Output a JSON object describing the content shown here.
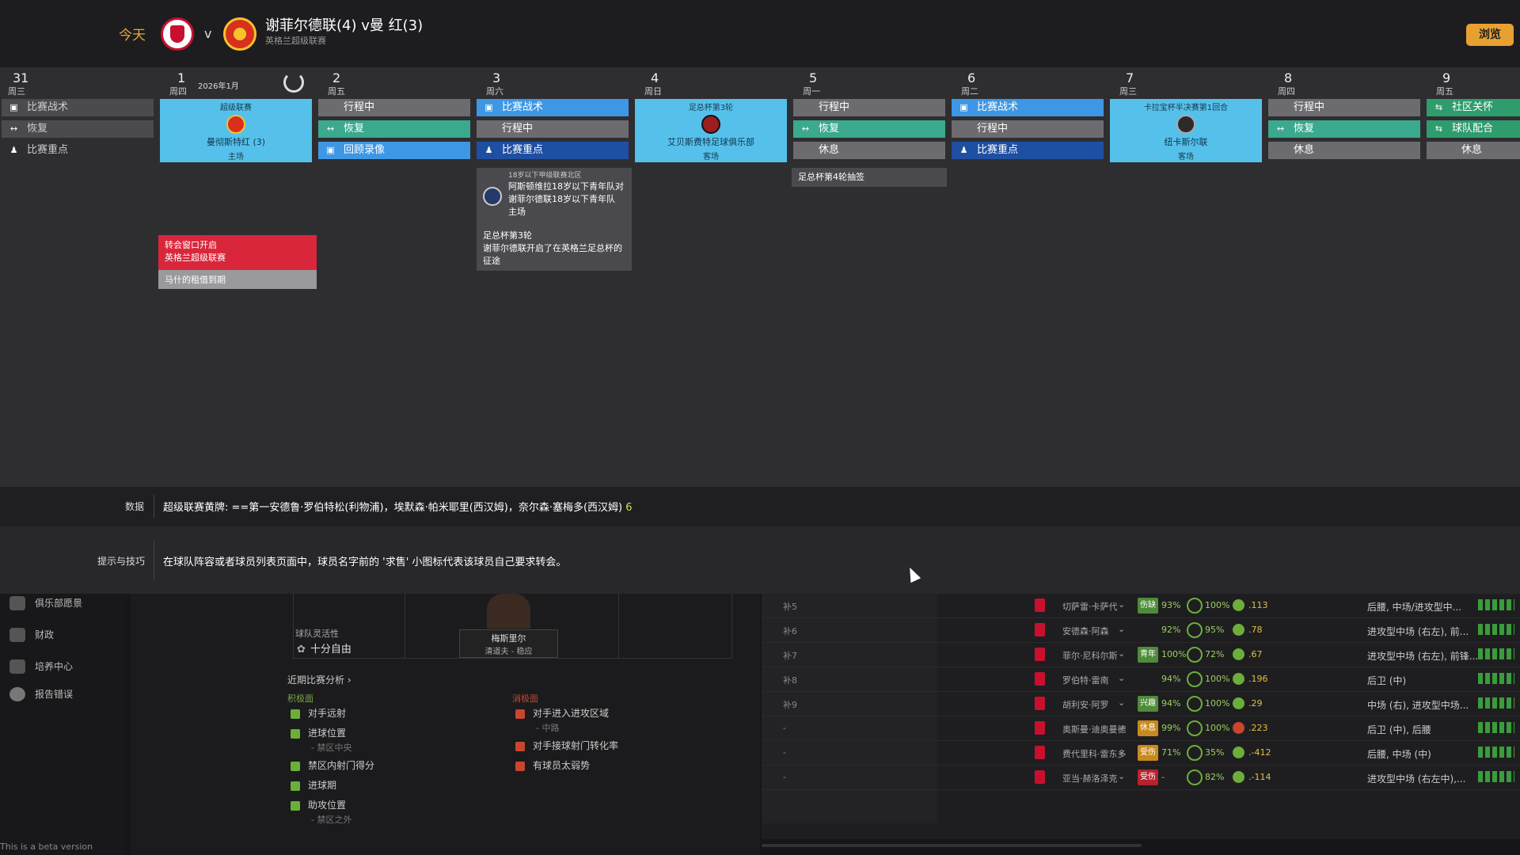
{
  "header": {
    "today_label": "今天",
    "vs": "v",
    "match_title": "谢菲尔德联(4) v曼 红(3)",
    "competition": "英格兰超级联赛",
    "browse_button": "浏览"
  },
  "calendar": {
    "month_label": "2026年1月",
    "days": [
      {
        "num": "31",
        "weekday": "周三"
      },
      {
        "num": "1",
        "weekday": "周四"
      },
      {
        "num": "2",
        "weekday": "周五"
      },
      {
        "num": "3",
        "weekday": "周六"
      },
      {
        "num": "4",
        "weekday": "周日"
      },
      {
        "num": "5",
        "weekday": "周一"
      },
      {
        "num": "6",
        "weekday": "周二"
      },
      {
        "num": "7",
        "weekday": "周三"
      },
      {
        "num": "8",
        "weekday": "周四"
      },
      {
        "num": "9",
        "weekday": "周五"
      }
    ],
    "labels": {
      "tactics": "比赛战术",
      "recovery": "恢复",
      "focus": "比赛重点",
      "travel": "行程中",
      "review": "回顾录像",
      "rest": "休息",
      "community": "社区关怀",
      "teamwork": "球队配合"
    },
    "match1": {
      "comp": "超级联赛",
      "opp": "曼彻斯特红 (3)",
      "venue": "主场"
    },
    "match4": {
      "comp": "足总杯第3轮",
      "opp": "艾贝斯费特足球俱乐部",
      "venue": "客场"
    },
    "match7": {
      "comp": "卡拉宝杯半决赛第1回合",
      "opp": "纽卡斯尔联",
      "venue": "客场"
    },
    "events": {
      "transfer_line1": "转会窗口开启",
      "transfer_line2": "英格兰超级联赛",
      "loan_end": "马什的租借到期",
      "u18_comp": "18岁以下甲级联赛北区",
      "u18_text": "阿斯顿维拉18岁以下青年队对谢菲尔德联18岁以下青年队",
      "u18_venue": "主场",
      "facup_title": "足总杯第3轮",
      "facup_text": "谢菲尔德联开启了在英格兰足总杯的征途",
      "facup_draw": "足总杯第4轮抽签"
    }
  },
  "infobar": {
    "label": "数据",
    "text": "超级联赛黄牌: ==第一安德鲁·罗伯特松(利物浦)，埃默森·帕米耶里(西汉姆)，奈尔森·塞梅多(西汉姆)",
    "number": "6"
  },
  "tipbar": {
    "label": "提示与技巧",
    "text": "在球队阵容或者球员列表页面中，球员名字前的 '求售' 小图标代表该球员自己要求转会。"
  },
  "sidenav": {
    "items": [
      "俱乐部愿景",
      "财政",
      "培养中心",
      "报告错误"
    ]
  },
  "tactics": {
    "flex_label": "球队灵活性",
    "flex_value": "十分自由",
    "player_name": "梅斯里尔",
    "player_role": "清道夫 - 稳应",
    "analysis_link": "近期比赛分析 ›",
    "positive_header": "积极面",
    "negative_header": "消极面",
    "positives": [
      "对手远射",
      "进球位置",
      "禁区内射门得分",
      "进球期",
      "助攻位置"
    ],
    "positive_subs": [
      "- 禁区中央",
      "- 禁区之外"
    ],
    "negatives": [
      "对手进入进攻区域",
      "对手接球射门转化率",
      "有球员太弱势"
    ],
    "negative_sub": "- 中路"
  },
  "squad": {
    "rows": [
      {
        "label": "补5",
        "name": "切萨雷·卡萨代",
        "tag": "伤缺",
        "cond": "93%",
        "sharp": "100%",
        "rating": ".113",
        "pos": "后腰, 中场/进攻型中...",
        "tag_color": "#4e8c3a",
        "status": "ok"
      },
      {
        "label": "补6",
        "name": "安德森·阿森",
        "tag": "",
        "cond": "92%",
        "sharp": "95%",
        "rating": ".78",
        "pos": "进攻型中场 (右左), 前...",
        "tag_color": "",
        "status": "ok"
      },
      {
        "label": "补7",
        "name": "菲尔·尼科尔斯",
        "tag": "青年",
        "cond": "100%",
        "sharp": "72%",
        "rating": ".67",
        "pos": "进攻型中场 (右左), 前锋...",
        "tag_color": "#4e8c3a",
        "status": "ok"
      },
      {
        "label": "补8",
        "name": "罗伯特·雷南",
        "tag": "",
        "cond": "94%",
        "sharp": "100%",
        "rating": ".196",
        "pos": "后卫 (中)",
        "tag_color": "",
        "status": "ok"
      },
      {
        "label": "补9",
        "name": "胡利安·阿罗",
        "tag": "兴趣",
        "cond": "94%",
        "sharp": "100%",
        "rating": ".29",
        "pos": "中场 (右), 进攻型中场...",
        "tag_color": "#4e8c3a",
        "status": "ok"
      },
      {
        "label": "-",
        "name": "奥斯曼·迪奥曼德",
        "tag": "休息",
        "cond": "99%",
        "sharp": "100%",
        "rating": ".223",
        "pos": "后卫 (中), 后腰",
        "tag_color": "#c88a1e",
        "status": "warn"
      },
      {
        "label": "-",
        "name": "费代里科·雷东多",
        "tag": "受伤",
        "cond": "71%",
        "sharp": "35%",
        "rating": ".-412",
        "pos": "后腰, 中场 (中)",
        "tag_color": "#c88a1e",
        "status": "ok"
      },
      {
        "label": "-",
        "name": "亚当·赫洛泽克",
        "tag": "受伤",
        "cond": "-",
        "sharp": "82%",
        "rating": ".-114",
        "pos": "进攻型中场 (右左中),...",
        "tag_color": "#b7222d",
        "status": "ok"
      }
    ]
  },
  "footer": {
    "beta": "This is a beta version"
  }
}
